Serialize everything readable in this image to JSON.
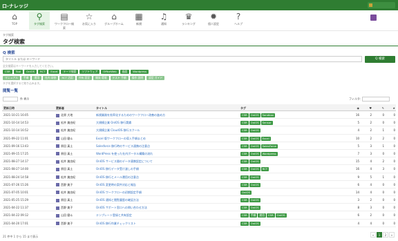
{
  "app": {
    "title": "ロ-ナレッジ"
  },
  "toolbar": {
    "items": [
      {
        "label": "TOP",
        "icon": "home-outline-icon"
      },
      {
        "label": "タグ検索",
        "icon": "search-icon"
      },
      {
        "label": "ワークフロー検索",
        "icon": "workflow-search-icon"
      },
      {
        "label": "お気に入り",
        "icon": "star-icon"
      },
      {
        "label": "グループホーム",
        "icon": "group-home-icon"
      },
      {
        "label": "新規",
        "icon": "new-icon"
      },
      {
        "label": "通知",
        "icon": "bell-icon"
      },
      {
        "label": "ランキング",
        "icon": "trophy-icon"
      },
      {
        "label": "個人設定",
        "icon": "gear-icon"
      },
      {
        "label": "ヘルプ",
        "icon": "help-icon"
      }
    ],
    "active_index": 1
  },
  "breadcrumb": "タグ検索",
  "page_title": "タグ検索",
  "search": {
    "heading": "Q 検索",
    "placeholder": "タイトル または キーワード",
    "button": "Q 検索",
    "hint": "全文検索はキーワードを入力してください。"
  },
  "tags": {
    "row1": [
      "CSR",
      "Tool",
      "OnIOS",
      "RCT",
      "Excel",
      "テーマ検索",
      "ソフトウェア",
      "OfficeWeb",
      "画面",
      "Wordpress"
    ],
    "row2": [
      "マニュアル",
      "手順",
      "運用",
      "社内 研修",
      "RCT 活用",
      "共有 設定",
      "開発 環境",
      "テスト 手順",
      "操作 説明",
      "設定 ガイド"
    ],
    "hint": "タグを選択すると絞り込みます。"
  },
  "list": {
    "heading": "閲覧一覧",
    "page_size_label": "件 表示",
    "filter_label": "フィルタ:",
    "columns": [
      "更新日時",
      "更新者",
      "タイトル",
      "タグ"
    ],
    "rows": [
      {
        "date": "2021-10-21 16:05",
        "user": "北原 大地",
        "title": "新規業務を効率化するためのワークフロー改善の進め方",
        "tags": [
          "CSR",
          "OnIOS",
          "Sandbox"
        ],
        "n": [
          16,
          2,
          0,
          0
        ]
      },
      {
        "date": "2021-10-14 14:53",
        "user": "松井 美由紀",
        "title": "大規模企業 OnIOS 移行実績",
        "tags": [
          "CSR",
          "OnIOS",
          "Sensor"
        ],
        "n": [
          5,
          2,
          0,
          0
        ]
      },
      {
        "date": "2021-10-14 16:52",
        "user": "松井 美由紀",
        "title": "大規模企業 CloudOS 移行スクール",
        "tags": [
          "CSR",
          "OnIOS"
        ],
        "n": [
          4,
          2,
          1,
          0
        ]
      },
      {
        "date": "2021-09-22 11:01",
        "user": "山田 健斗",
        "title": "Excel 版ワークフローの導入手順まとめ",
        "tags": [
          "CSR",
          "OnIOS",
          "Excel"
        ],
        "n": [
          10,
          2,
          2,
          0
        ]
      },
      {
        "date": "2021-09-16 13:43",
        "user": "原田 真土",
        "title": "Salesforce 移行時のサービス連携の注意点",
        "tags": [
          "CSR",
          "OnIOS",
          "SalesForce"
        ],
        "n": [
          5,
          3,
          1,
          0
        ]
      },
      {
        "date": "2021-09-15 17:25",
        "user": "原田 真土",
        "title": "WordPress を使った社内ポータル構築の流れ",
        "tags": [
          "CSR",
          "OnIOS",
          "Wordpress"
        ],
        "n": [
          7,
          3,
          0,
          0
        ]
      },
      {
        "date": "2021-08-27 14:17",
        "user": "松井 美由紀",
        "title": "OnIOS サービス間のデータ連携設定について",
        "tags": [
          "CSR",
          "OnIOS"
        ],
        "n": [
          15,
          4,
          2,
          0
        ]
      },
      {
        "date": "2021-08-27 14:00",
        "user": "原田 真土",
        "title": "OnIOS 移行データ受け渡しの手順",
        "tags": [
          "CSR",
          "OnIOS",
          "RCT"
        ],
        "n": [
          16,
          4,
          3,
          0
        ]
      },
      {
        "date": "2021-08-24 14:58",
        "user": "松井 美由紀",
        "title": "OnIOS 移行とメール運用の注意点",
        "tags": [
          "CSR",
          "OnIOS"
        ],
        "n": [
          9,
          5,
          1,
          0
        ]
      },
      {
        "date": "2021-07-26 15:26",
        "user": "西野 美子",
        "title": "OnIOS 変更時の案件対応と報告",
        "tags": [
          "CSR",
          "OnIOS"
        ],
        "n": [
          6,
          4,
          0,
          0
        ]
      },
      {
        "date": "2021-07-05 10:01",
        "user": "松井 美由紀",
        "title": "OnIOS ワークフローの初期設定手順",
        "tags": [
          "OnIOS"
        ],
        "n": [
          14,
          4,
          0,
          0
        ]
      },
      {
        "date": "2021-05-25 15:29",
        "user": "原田 真土",
        "title": "OnIOS 通知と閲覧履歴の確認方法",
        "tags": [
          "CSR",
          "OnIOS"
        ],
        "n": [
          3,
          2,
          0,
          0
        ]
      },
      {
        "date": "2021-04-22 11:37",
        "user": "西野 美子",
        "title": "OnIOS サポート窓口への問い合わせ方法",
        "tags": [
          "CSR",
          "OnIOS"
        ],
        "n": [
          8,
          3,
          0,
          0
        ]
      },
      {
        "date": "2021-04-22 09:12",
        "user": "山田 健斗",
        "title": "テンプレート登録と共有設定",
        "tags": [
          "CSR",
          "手順",
          "運用",
          "CSR",
          "OnIOS"
        ],
        "n": [
          6,
          2,
          0,
          0
        ]
      },
      {
        "date": "2021-04-20 17:01",
        "user": "西野 美子",
        "title": "OnIOS 移行作業チェックリスト",
        "tags": [
          "CSR",
          "OnIOS"
        ],
        "n": [
          4,
          4,
          0,
          0
        ]
      }
    ]
  },
  "footer": {
    "summary": "21 件中 1 から 15 まで表示",
    "pages": [
      "«",
      "1",
      "2",
      "»"
    ],
    "current_page": "1"
  },
  "colors": {
    "brand": "#2f7d32",
    "tag": "#3f9a46",
    "link": "#2e6ec0",
    "heading": "#2f4f9a"
  }
}
